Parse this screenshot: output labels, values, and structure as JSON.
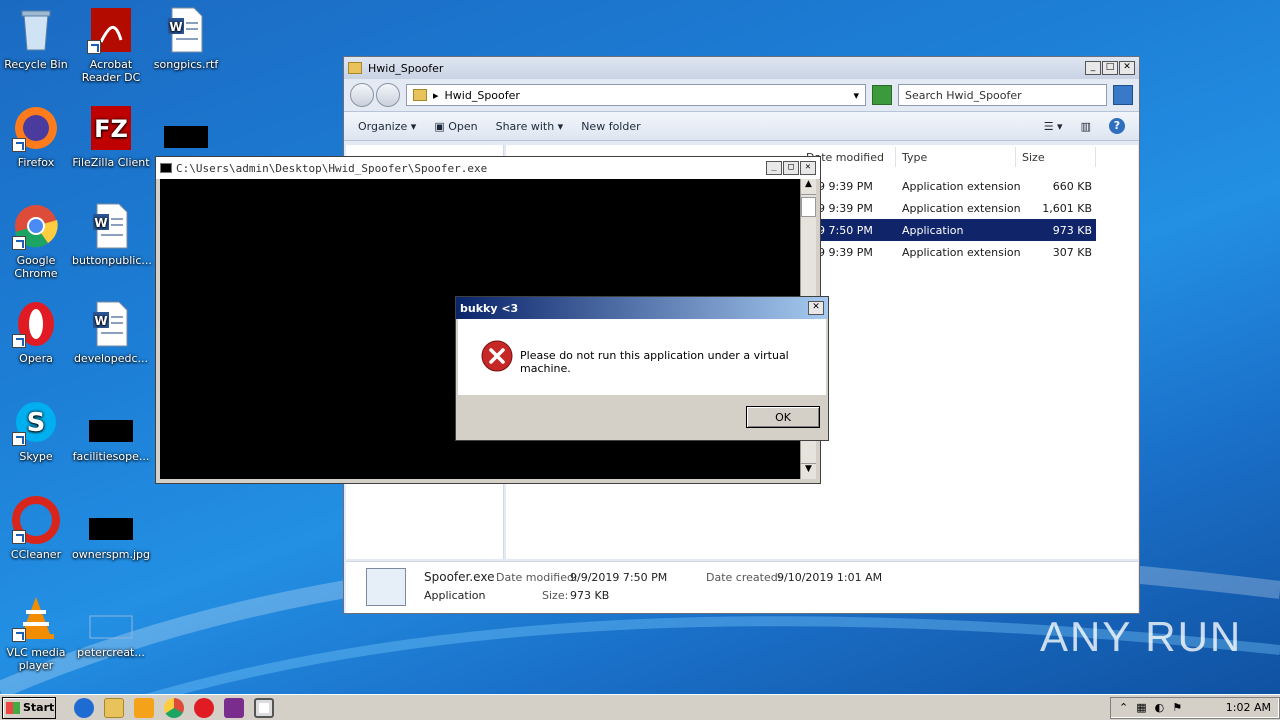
{
  "desktop": {
    "icons": [
      {
        "label": "Recycle Bin"
      },
      {
        "label": "Acrobat Reader DC"
      },
      {
        "label": "songpics.rtf"
      },
      {
        "label": "Firefox"
      },
      {
        "label": "FileZilla Client"
      },
      {
        "label": "Google Chrome"
      },
      {
        "label": "buttonpublic..."
      },
      {
        "label": "Opera"
      },
      {
        "label": "developedc..."
      },
      {
        "label": "Skype"
      },
      {
        "label": "facilitiesope..."
      },
      {
        "label": "CCleaner"
      },
      {
        "label": "ownerspm.jpg"
      },
      {
        "label": "VLC media player"
      },
      {
        "label": "petercreat..."
      }
    ]
  },
  "explorer": {
    "title": "Hwid_Spoofer",
    "address": "Hwid_Spoofer",
    "search_placeholder": "Search Hwid_Spoofer",
    "toolbar": {
      "organize": "Organize",
      "open": "Open",
      "share_with": "Share with",
      "new_folder": "New folder"
    },
    "columns": {
      "modified": "Date modified",
      "type": "Type",
      "size": "Size"
    },
    "files": [
      {
        "modified": "9 9:39 PM",
        "type": "Application extension",
        "size": "660 KB"
      },
      {
        "modified": "9 9:39 PM",
        "type": "Application extension",
        "size": "1,601 KB"
      },
      {
        "modified": "9 7:50 PM",
        "type": "Application",
        "size": "973 KB"
      },
      {
        "modified": "9 9:39 PM",
        "type": "Application extension",
        "size": "307 KB"
      }
    ],
    "details": {
      "name": "Spoofer.exe",
      "modified_label": "Date modified:",
      "modified_value": "9/9/2019 7:50 PM",
      "created_label": "Date created:",
      "created_value": "9/10/2019 1:01 AM",
      "type": "Application",
      "size_label": "Size:",
      "size_value": "973 KB"
    }
  },
  "console": {
    "title": "C:\\Users\\admin\\Desktop\\Hwid_Spoofer\\Spoofer.exe"
  },
  "msgbox": {
    "title": "bukky <3",
    "message": "Please do not run this application under a virtual machine.",
    "ok": "OK"
  },
  "taskbar": {
    "start": "Start",
    "clock": "1:02 AM"
  },
  "watermark": "ANY RUN",
  "colors": {
    "accent": "#10246a",
    "error": "#c62828"
  }
}
